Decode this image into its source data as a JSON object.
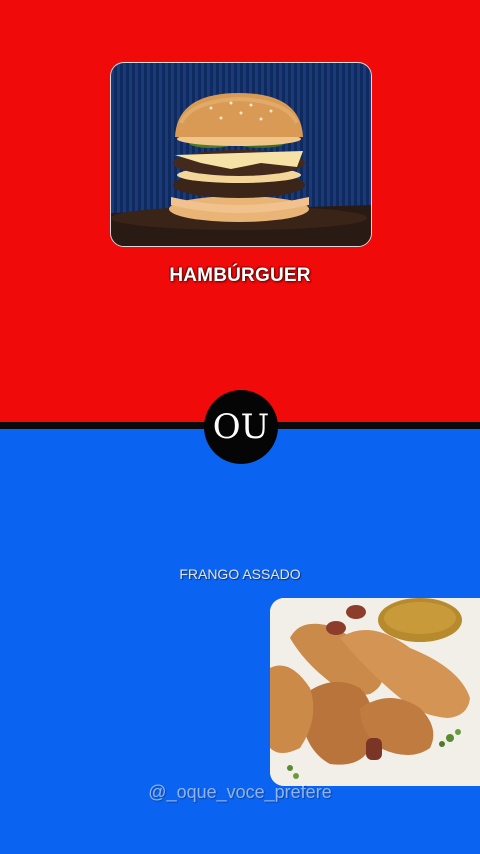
{
  "option_top": {
    "label": "HAMBÚRGUER",
    "color": "#f00a0a",
    "image": "burger-photo"
  },
  "divider": {
    "text": "OU"
  },
  "option_bottom": {
    "label": "FRANGO ASSADO",
    "color": "#0b63f2",
    "image": "roast-chicken-photo"
  },
  "watermark": {
    "text": "@_oque_voce_prefere"
  }
}
